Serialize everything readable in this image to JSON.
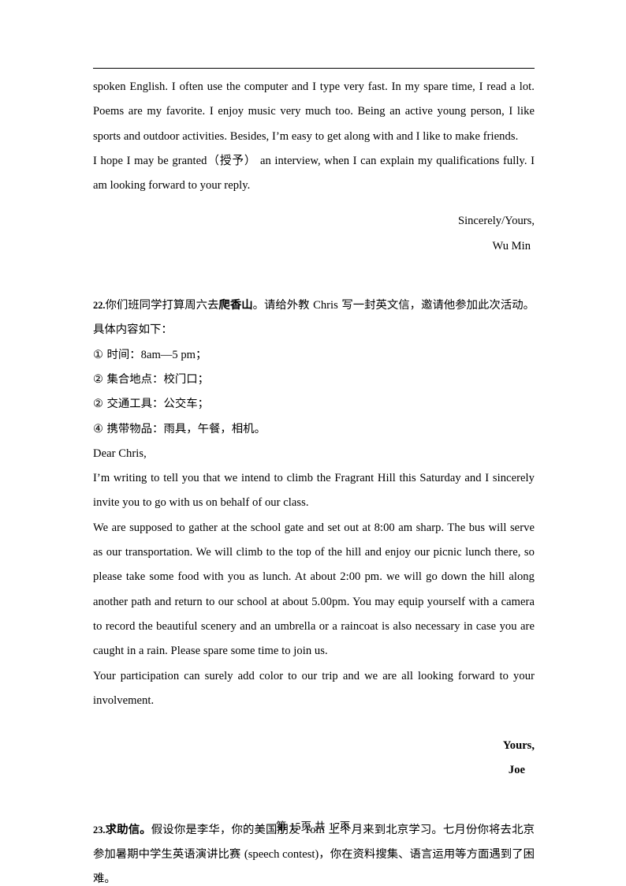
{
  "document": {
    "page_footer": {
      "prefix": "第",
      "current_page": "15",
      "mid": "页 共",
      "total_pages": "17",
      "suffix": "页"
    }
  },
  "letter_one": {
    "body_paragraph": "spoken English. I often use the computer and I type very fast. In my spare time, I read a lot. Poems are my favorite. I enjoy music very much too. Being an active young person, I like sports and outdoor activities. Besides, I’m easy to get along with and I like to make friends.",
    "closing_paragraph": "I hope I may be granted（授予）  an interview, when I can explain my qualifications fully. I am looking forward to your reply.",
    "signoff": "Sincerely/Yours,",
    "signature": "Wu Min"
  },
  "question_22": {
    "number": "22.",
    "prompt_part1": "你们班同学打算周六去",
    "prompt_bold": "爬香山",
    "prompt_part2": "。请给外教 ",
    "prompt_name": "Chris",
    "prompt_part3": " 写一封英文信，邀请他参加此次活动。具体内容如下：",
    "items": [
      {
        "marker": "①",
        "label": "时间：",
        "value": "8am—5 pm",
        "tail": "；"
      },
      {
        "marker": "②",
        "label": "集合地点：校门口；",
        "value": "",
        "tail": ""
      },
      {
        "marker": "②",
        "label": "交通工具：公交车；",
        "value": "",
        "tail": ""
      },
      {
        "marker": "④",
        "label": "携带物品：雨具，午餐，相机。",
        "value": "",
        "tail": ""
      }
    ],
    "salutation": "Dear Chris,",
    "paragraph_1": "I’m writing to tell you that we intend to climb the Fragrant Hill this Saturday and I sincerely invite you to go with us on behalf of our class.",
    "paragraph_2": "We are supposed to gather at the school gate and set out at 8:00 am sharp. The bus will  serve as our transportation. We will climb to the top of the hill and enjoy our picnic lunch there, so please take some food with you as lunch. At about 2:00 pm. we will go down the hill along another path and return to our school at about 5.00pm. You may equip yourself with a camera to record the beautiful scenery and an umbrella or a raincoat is also necessary in case you are caught in a rain. Please spare some time to join us.",
    "paragraph_3": "Your participation can surely add color to our trip and we are all looking forward to your involvement.",
    "signoff": "Yours,",
    "signature": "Joe"
  },
  "question_23": {
    "number": "23.",
    "title_bold": "求助信。",
    "prompt_part1": "假设你是李华，你的美国朋友 ",
    "prompt_name": "Tom",
    "prompt_part2": " 上个月来到北京学习。七月份你将去北京参加暑期中学生英语演讲比赛 ",
    "prompt_en": "(speech contest)",
    "prompt_part3": "，你在资料搜集、语言运用等方面遇到了困难。"
  }
}
